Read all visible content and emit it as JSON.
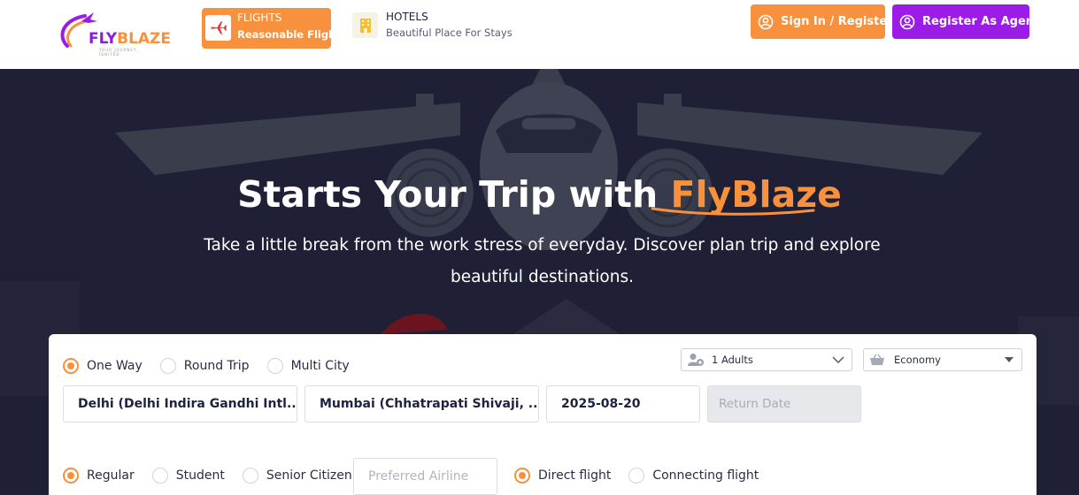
{
  "header": {
    "logo": {
      "brand_part1": "FLY",
      "brand_part2": "BLAZE",
      "tagline": "YOUR JOURNEY, IGNITED"
    },
    "tabs": [
      {
        "title": "FLIGHTS",
        "subtitle": "Reasonable Flights",
        "icon": "airplane-icon",
        "active": true
      },
      {
        "title": "HOTELS",
        "subtitle": "Beautiful Place For Stays",
        "icon": "hotel-icon",
        "active": false
      }
    ],
    "sign_in_label": "Sign In / Register",
    "register_agent_label": "Register As Agent"
  },
  "hero": {
    "title_prefix": "Starts Your Trip with ",
    "title_accent": "FlyBlaze",
    "subtitle": "Take a little break from the work stress of everyday. Discover plan trip and explore beautiful destinations."
  },
  "search": {
    "trip_types": [
      {
        "label": "One Way",
        "selected": true
      },
      {
        "label": "Round Trip",
        "selected": false
      },
      {
        "label": "Multi City",
        "selected": false
      }
    ],
    "travellers": "1 Adults",
    "cabin_class": "Economy",
    "from": "Delhi (Delhi Indira Gandhi Intl...",
    "to": "Mumbai (Chhatrapati Shivaji, ...",
    "depart_date": "2025-08-20",
    "return_placeholder": "Return Date",
    "fare_types": [
      {
        "label": "Regular",
        "selected": true
      },
      {
        "label": "Student",
        "selected": false
      },
      {
        "label": "Senior Citizen",
        "selected": false
      }
    ],
    "airline_placeholder": "Preferred Airline",
    "flight_types": [
      {
        "label": "Direct flight",
        "selected": true
      },
      {
        "label": "Connecting flight",
        "selected": false
      }
    ]
  },
  "colors": {
    "accent": "#f7913d",
    "purple": "#9b1ce6",
    "hero_bg": "#1f1f36",
    "navy_text": "#1e2140"
  }
}
